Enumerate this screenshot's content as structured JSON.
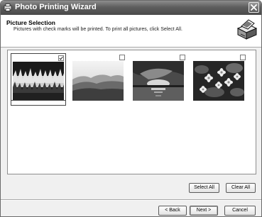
{
  "window": {
    "title": "Photo Printing Wizard",
    "icons": {
      "app": "photo-printer-icon",
      "close": "close-icon"
    }
  },
  "header": {
    "title": "Picture Selection",
    "subtitle": "Pictures with check marks will be printed.  To print all pictures, click Select All.",
    "icon": "printer-icon"
  },
  "pictures": [
    {
      "name": "grass-field",
      "checked": true
    },
    {
      "name": "mountain-landscape",
      "checked": false
    },
    {
      "name": "sunset-over-water",
      "checked": false
    },
    {
      "name": "water-lilies",
      "checked": false
    }
  ],
  "buttons": {
    "select_all": "Select All",
    "clear_all": "Clear All",
    "back": "< Back",
    "next": "Next >",
    "cancel": "Cancel"
  }
}
